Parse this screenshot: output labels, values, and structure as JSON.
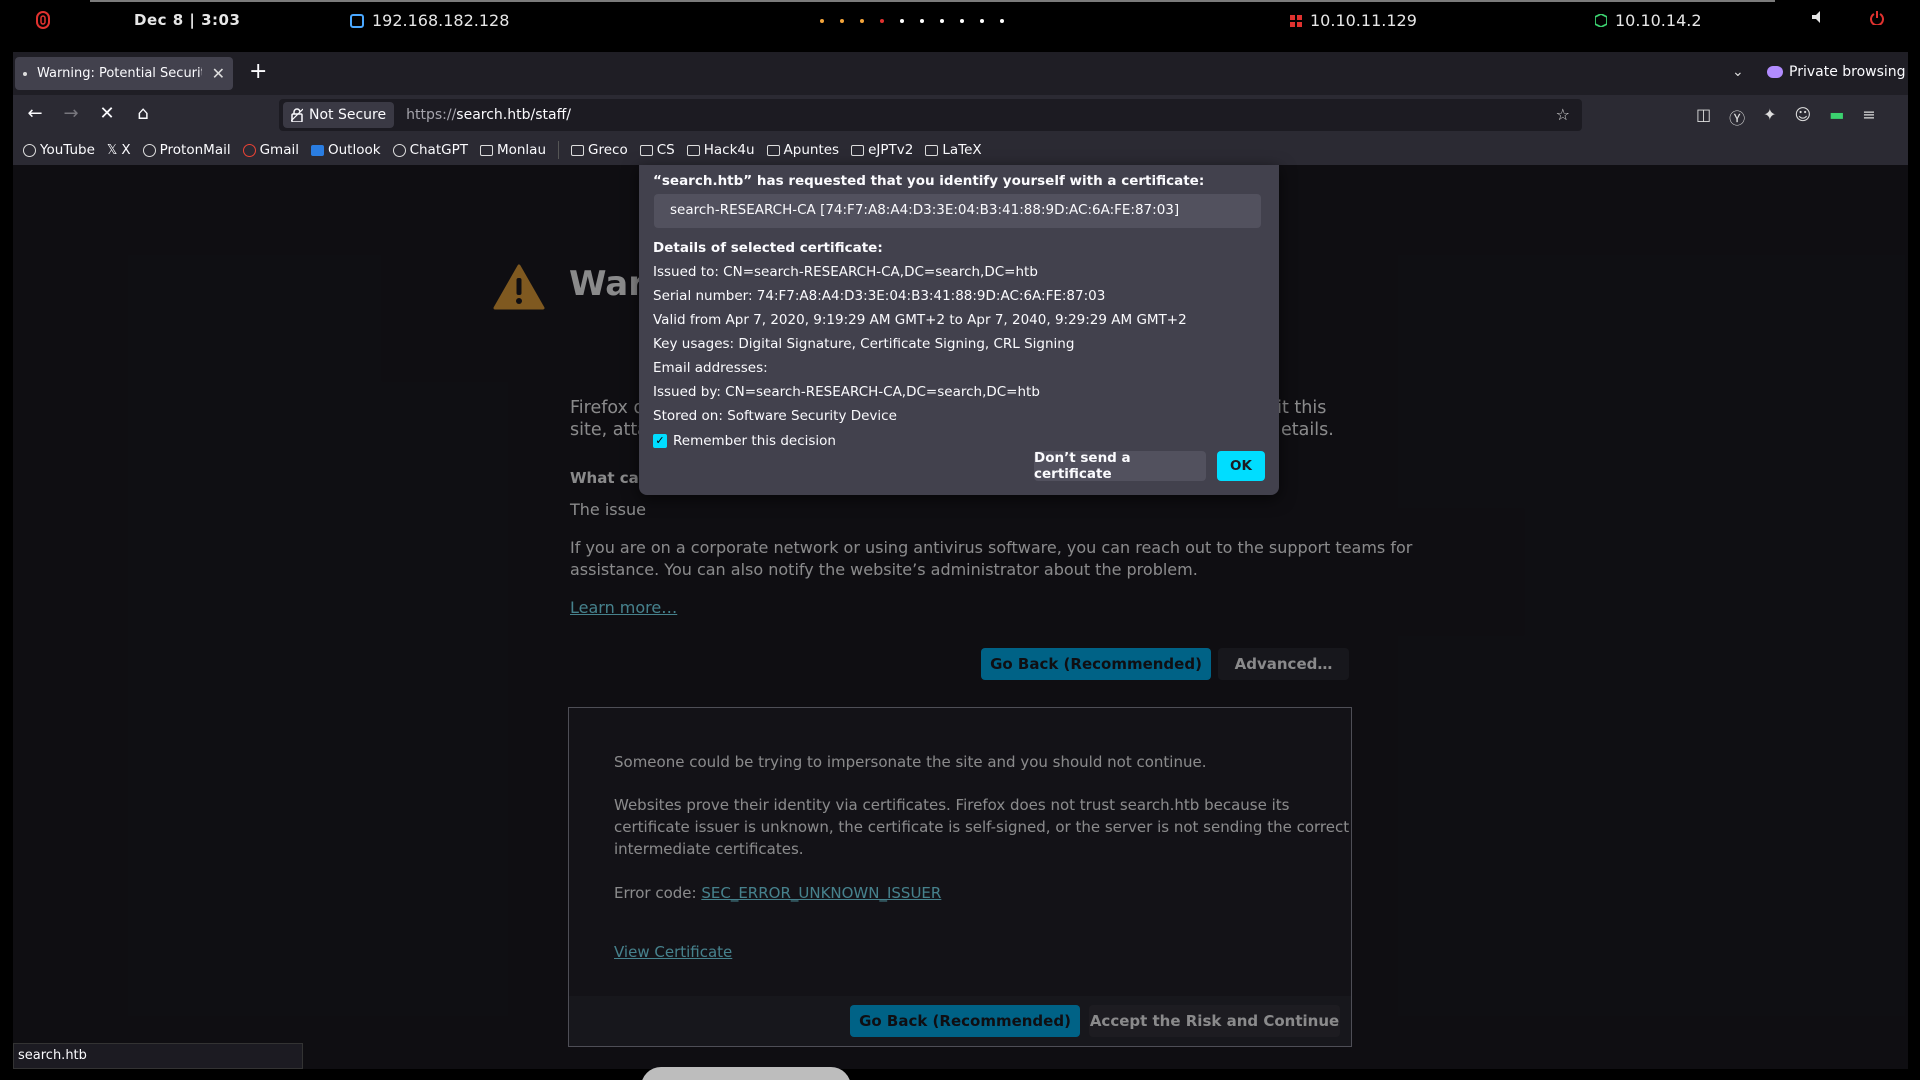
{
  "system_bar": {
    "clock": "Dec 8 | 3:03",
    "vm_ip": "192.168.182.128",
    "target_ip": "10.10.11.129",
    "vpn_ip": "10.10.14.2"
  },
  "browser": {
    "tab_title": "Warning: Potential Security",
    "private_label": "Private browsing",
    "not_secure_label": "Not Secure",
    "url_scheme": "https://",
    "url_rest": "search.htb/staff/",
    "bookmarks": [
      {
        "label": "YouTube",
        "icon": "globe-icon"
      },
      {
        "label": "X",
        "icon": "x-icon"
      },
      {
        "label": "ProtonMail",
        "icon": "globe-icon"
      },
      {
        "label": "Gmail",
        "icon": "google-icon"
      },
      {
        "label": "Outlook",
        "icon": "outlook-icon"
      },
      {
        "label": "ChatGPT",
        "icon": "chatgpt-icon"
      },
      {
        "label": "Monlau",
        "icon": "folder-icon"
      },
      {
        "label": "Greco",
        "icon": "folder-icon"
      },
      {
        "label": "CS",
        "icon": "folder-icon"
      },
      {
        "label": "Hack4u",
        "icon": "folder-icon"
      },
      {
        "label": "Apuntes",
        "icon": "folder-icon"
      },
      {
        "label": "eJPTv2",
        "icon": "folder-icon"
      },
      {
        "label": "LaTeX",
        "icon": "folder-icon"
      }
    ],
    "status_text": "search.htb"
  },
  "warning_page": {
    "title": "Warn",
    "intro_line1_start": "Firefox d",
    "intro_line1_end": "sit this",
    "intro_line2_start": "site, atta",
    "intro_line2_end": "etails.",
    "what_can_heading": "What can",
    "issue_start": "The issue",
    "corporate_line1": "If you are on a corporate network or using antivirus software, you can reach out to the support teams for",
    "corporate_line2": "assistance. You can also notify the website’s administrator about the problem.",
    "learn_more": "Learn more…",
    "go_back_label": "Go Back (Recommended)",
    "advanced_label": "Advanced…",
    "advanced": {
      "impersonate": "Someone could be trying to impersonate the site and you should not continue.",
      "prove_line1": "Websites prove their identity via certificates. Firefox does not trust search.htb because its",
      "prove_line2": "certificate issuer is unknown, the certificate is self-signed, or the server is not sending the correct",
      "prove_line3": "intermediate certificates.",
      "error_code_label": "Error code:",
      "error_code": "SEC_ERROR_UNKNOWN_ISSUER",
      "view_certificate": "View Certificate",
      "go_back_label": "Go Back (Recommended)",
      "accept_label": "Accept the Risk and Continue"
    }
  },
  "cert_dialog": {
    "request_heading": "“search.htb” has requested that you identify yourself with a certificate:",
    "selected_cert": "search-RESEARCH-CA [74:F7:A8:A4:D3:3E:04:B3:41:88:9D:AC:6A:FE:87:03]",
    "details_heading": "Details of selected certificate:",
    "issued_to": "Issued to: CN=search-RESEARCH-CA,DC=search,DC=htb",
    "serial": "Serial number: 74:F7:A8:A4:D3:3E:04:B3:41:88:9D:AC:6A:FE:87:03",
    "valid": "Valid from Apr 7, 2020, 9:19:29 AM GMT+2 to Apr 7, 2040, 9:29:29 AM GMT+2",
    "key_usages": "Key usages: Digital Signature, Certificate Signing, CRL Signing",
    "email": "Email addresses:",
    "issued_by": "Issued by: CN=search-RESEARCH-CA,DC=search,DC=htb",
    "stored_on": "Stored on: Software Security Device",
    "remember_label": "Remember this decision",
    "dont_send_label": "Don’t send a certificate",
    "ok_label": "OK"
  },
  "colors": {
    "accent": "#00ddff",
    "primary_button": "#00b3f4",
    "link": "#80ebff",
    "warning_icon": "#e8a33b"
  }
}
